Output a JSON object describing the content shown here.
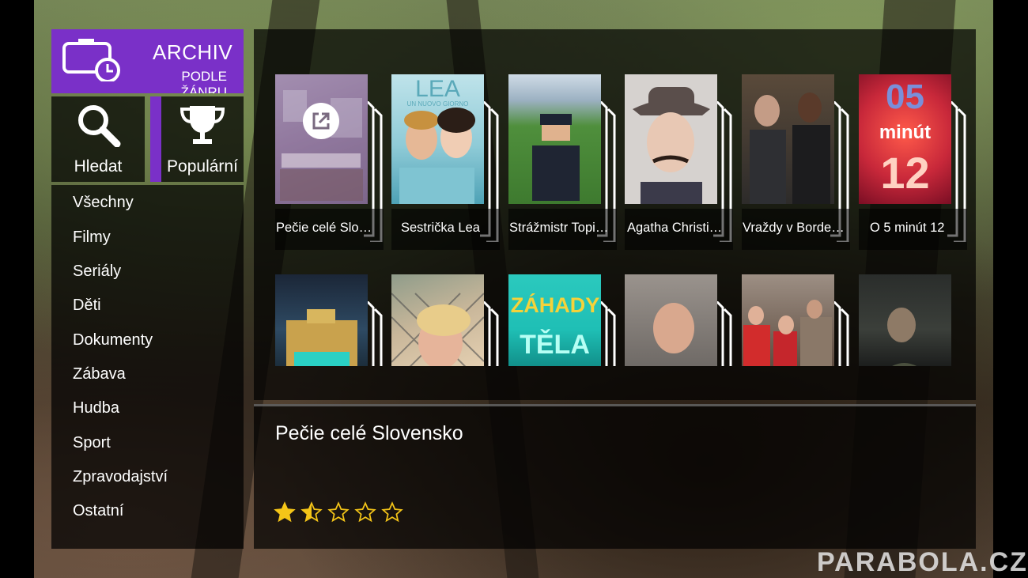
{
  "header": {
    "title": "ARCHIV",
    "subtitle": "PODLE ŽÁNRU",
    "icon": "calendar-clock-icon",
    "accent_color": "#7a30c8"
  },
  "tiles": {
    "search": {
      "label": "Hledat",
      "icon": "magnifier-icon"
    },
    "popular": {
      "label": "Populární",
      "icon": "trophy-icon"
    }
  },
  "genres": [
    "Všechny",
    "Filmy",
    "Seriály",
    "Děti",
    "Dokumenty",
    "Zábava",
    "Hudba",
    "Sport",
    "Zpravodajství",
    "Ostatní"
  ],
  "row1": [
    {
      "title": "Pečie celé Slovensko",
      "selected": true,
      "poster_color": "#8a7a8f"
    },
    {
      "title": "Sestrička Lea",
      "poster_text": "LEA",
      "poster_sub": "UN NUOVO GIORNO",
      "poster_color": "#6fb8c9"
    },
    {
      "title": "Strážmistr Topinka",
      "poster_color": "#4f8f3c"
    },
    {
      "title": "Agatha Christie: Poirot",
      "poster_color": "#cfc6c2"
    },
    {
      "title": "Vraždy v Bordeaux",
      "poster_color": "#3a3a3a"
    },
    {
      "title": "O 5 minút 12",
      "poster_text_top": "05",
      "poster_text_mid": "minút",
      "poster_text_bot": "12",
      "poster_color": "#c8283a"
    }
  ],
  "row2": [
    {
      "poster_color": "#2e4a63"
    },
    {
      "poster_color": "#c9b79a"
    },
    {
      "poster_color": "#1fbfb5",
      "poster_text": "ZÁHADY",
      "poster_sub": "TĚLA"
    },
    {
      "poster_color": "#6f6a66"
    },
    {
      "poster_color": "#b04a36"
    },
    {
      "poster_color": "#3b3f3a"
    }
  ],
  "detail": {
    "title": "Pečie celé Slovensko",
    "rating": 1.5,
    "rating_max": 5,
    "star_color": "#f4c518"
  },
  "watermark": "PARABOLA.CZ"
}
